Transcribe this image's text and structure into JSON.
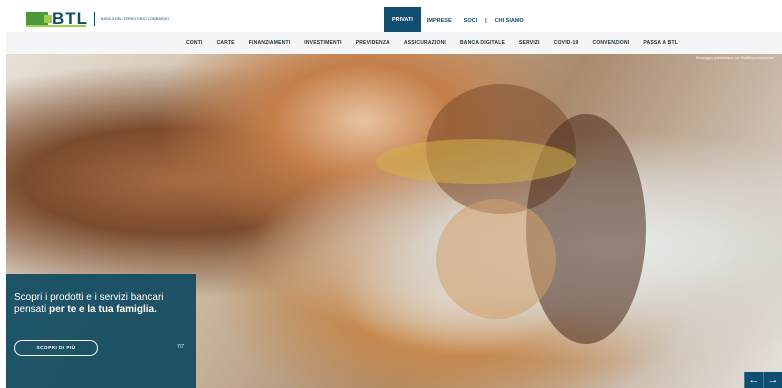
{
  "header": {
    "logo_text": "BTL",
    "logo_sub": "BANCA DEL TERRITORIO LOMBARDO",
    "nav": [
      {
        "label": "PRIVATI",
        "active": true
      },
      {
        "label": "IMPRESE",
        "active": false
      },
      {
        "label": "SOCI",
        "active": false
      },
      {
        "label": "|",
        "active": false
      },
      {
        "label": "CHI SIAMO",
        "active": false
      }
    ]
  },
  "subnav": [
    "CONTI",
    "CARTE",
    "FINANZIAMENTI",
    "INVESTIMENTI",
    "PREVIDENZA",
    "ASSICURAZIONI",
    "BANCA DIGITALE",
    "SERVIZI",
    "COVID-19",
    "CONVENZIONI",
    "PASSA A BTL"
  ],
  "hero": {
    "note": "Messaggio pubblicitario con finalità promozionale",
    "headline_start": "Scopri i prodotti e i servizi bancari pensati ",
    "headline_bold": "per te e la tua famiglia.",
    "cta": "SCOPRI DI PIÙ",
    "counter": "7/7",
    "prev_icon": "←",
    "next_icon": "→"
  }
}
